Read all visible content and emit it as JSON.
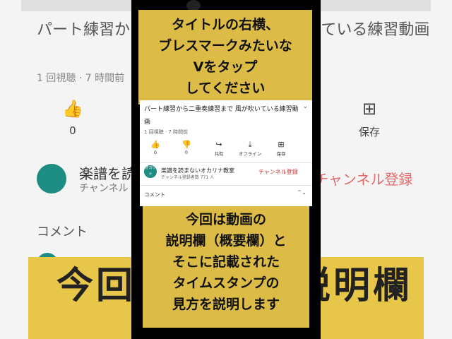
{
  "background": {
    "title": "パート練習から二重奏練習まで 風が吹いている練習動画",
    "views": "1 回視聴 · 7 時間前",
    "actions": [
      {
        "icon": "thumb-up-icon",
        "label": "0"
      },
      {
        "icon": "save-plus-icon",
        "label": "保存"
      }
    ],
    "channel": "楽譜を読まないオカリナ教室",
    "channel_sub": "チャンネル",
    "subscribe": "チャンネル登録",
    "comment": "コメント",
    "banner": "今回は動画の説明欄"
  },
  "caption_top": [
    "タイトルの右横、",
    "ブレスマークみたいな",
    "Vをタップ",
    "してください"
  ],
  "caption_bottom": [
    "今回は動画の",
    "説明欄（概要欄）と",
    "そこに記載された",
    "タイムスタンプの",
    "見方を説明します"
  ],
  "video": {
    "title": "パート練習から二重奏練習まで 風が吹いている練習動画",
    "meta": "1 回視聴 · 7 時間前",
    "actions": [
      {
        "icon": "thumb-up-icon",
        "glyph": "👍",
        "label": "0"
      },
      {
        "icon": "thumb-down-icon",
        "glyph": "👎",
        "label": "0"
      },
      {
        "icon": "share-icon",
        "glyph": "↪",
        "label": "共有"
      },
      {
        "icon": "download-icon",
        "glyph": "⤓",
        "label": "オフライン"
      },
      {
        "icon": "save-plus-icon",
        "glyph": "⊞",
        "label": "保存"
      }
    ],
    "channel_avatar": "オカリナ",
    "channel_name": "楽譜を読まないオカリナ教室",
    "channel_subs": "チャンネル登録者数 771 人",
    "subscribe": "チャンネル登録",
    "comment_label": "コメント"
  },
  "colors": {
    "caption_yellow": "#e8c64a",
    "avatar_teal": "#1d8c82",
    "subscribe_red": "#d32f2f"
  }
}
